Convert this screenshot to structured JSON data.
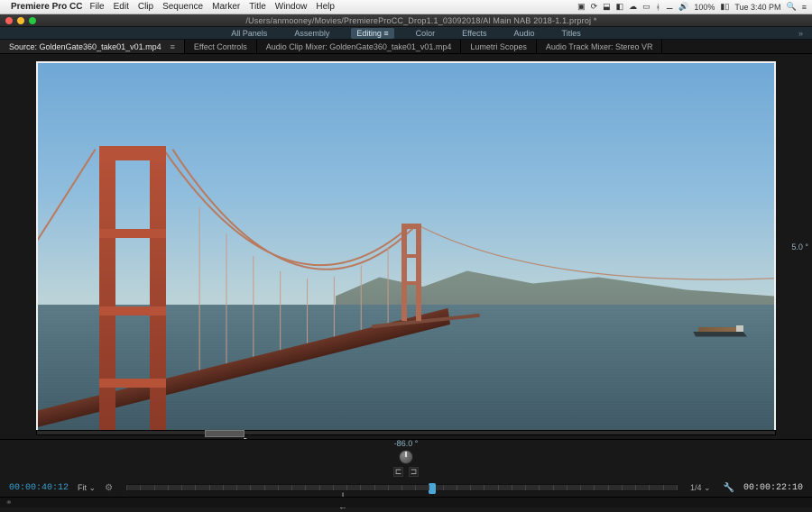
{
  "mac": {
    "app_name": "Premiere Pro CC",
    "menus": [
      "File",
      "Edit",
      "Clip",
      "Sequence",
      "Marker",
      "Title",
      "Window",
      "Help"
    ],
    "battery": "100%",
    "clock": "Tue 3:40 PM"
  },
  "window": {
    "title": "/Users/anmooney/Movies/PremiereProCC_Drop1.1_03092018/Al Main NAB 2018-1.1.prproj *"
  },
  "workspaces": {
    "items": [
      "All Panels",
      "Assembly",
      "Editing",
      "Color",
      "Effects",
      "Audio",
      "Titles"
    ],
    "active": "Editing",
    "overflow": "»"
  },
  "tabs": {
    "items": [
      {
        "label": "Source: GoldenGate360_take01_v01.mp4",
        "active": true
      },
      {
        "label": "Effect Controls",
        "active": false
      },
      {
        "label": "Audio Clip Mixer: GoldenGate360_take01_v01.mp4",
        "active": false
      },
      {
        "label": "Lumetri Scopes",
        "active": false
      },
      {
        "label": "Audio Track Mixer: Stereo VR",
        "active": false
      }
    ],
    "menu_caret": "≡"
  },
  "vr": {
    "side_readout": "5.0 °",
    "angle": "-86.0 °"
  },
  "transport": {
    "in_tc": "00:00:40:12",
    "out_tc": "00:00:22:10",
    "fit_label": "Fit",
    "quality": "1/4",
    "icons": {
      "mark_in": "{",
      "mark_out": "}",
      "goto_in": "|←",
      "step_back": "◀|",
      "play": "▶",
      "step_fwd": "|▶",
      "goto_out": "→|",
      "insert": "⇥",
      "overwrite": "⤓",
      "export": "⎘",
      "vr": "⊕",
      "add_marker": "▾",
      "plus": "+",
      "mark_range_l": "⊏",
      "mark_range_r": "⊐",
      "wrench": "🔧",
      "caret": "⌄",
      "settings": "⚙"
    }
  },
  "footer": {
    "link": "⚭"
  }
}
